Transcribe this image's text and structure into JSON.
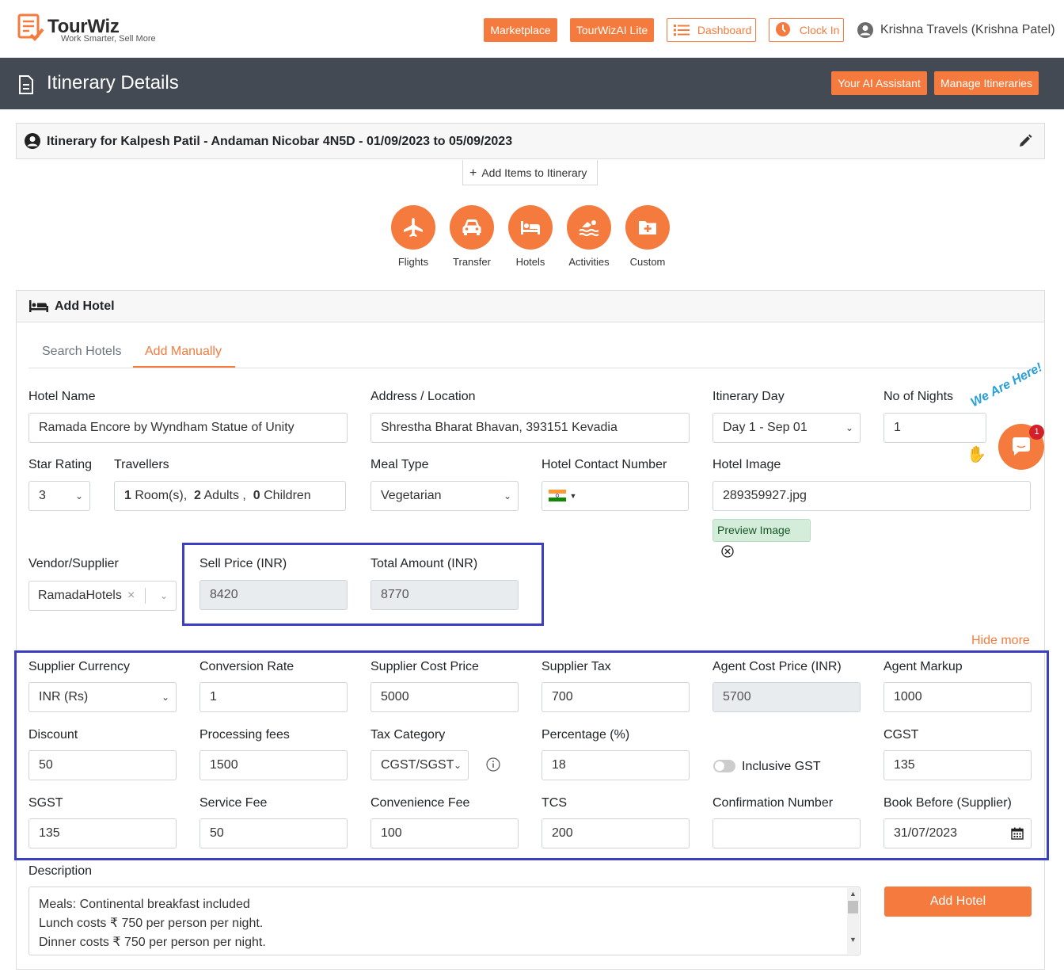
{
  "brand": {
    "name": "TourWiz",
    "tagline": "Work Smarter, Sell More"
  },
  "topnav": {
    "marketplace": "Marketplace",
    "tourwizai": "TourWizAI Lite",
    "dashboard": "Dashboard",
    "clock_in": "Clock In",
    "user": "Krishna Travels (Krishna Patel)"
  },
  "header": {
    "title": "Itinerary Details",
    "ai_assistant": "Your AI Assistant",
    "manage": "Manage Itineraries"
  },
  "itinerary": {
    "title": "Itinerary for Kalpesh Patil - Andaman Nicobar 4N5D - 01/09/2023 to 05/09/2023",
    "add_items": "Add Items to Itinerary"
  },
  "categories": [
    "Flights",
    "Transfer",
    "Hotels",
    "Activities",
    "Custom"
  ],
  "card": {
    "title": "Add Hotel",
    "tabs": [
      "Search Hotels",
      "Add Manually"
    ],
    "hide_more": "Hide more"
  },
  "form": {
    "hotel_name": {
      "label": "Hotel Name",
      "value": "Ramada Encore by Wyndham Statue of Unity"
    },
    "address": {
      "label": "Address / Location",
      "value": "Shrestha Bharat Bhavan, 393151 Kevadia"
    },
    "itinerary_day": {
      "label": "Itinerary Day",
      "value": "Day 1 - Sep 01"
    },
    "nights": {
      "label": "No of Nights",
      "value": "1"
    },
    "star_rating": {
      "label": "Star Rating",
      "value": "3"
    },
    "travellers": {
      "label": "Travellers",
      "rooms": "1",
      "rooms_text": "Room(s),",
      "adults": "2",
      "adults_text": "Adults ,",
      "children": "0",
      "children_text": "Children"
    },
    "meal_type": {
      "label": "Meal Type",
      "value": "Vegetarian"
    },
    "contact": {
      "label": "Hotel Contact Number"
    },
    "hotel_image": {
      "label": "Hotel Image",
      "value": "289359927.jpg",
      "preview": "Preview Image"
    },
    "vendor": {
      "label": "Vendor/Supplier",
      "value": "RamadaHotels"
    },
    "sell_price": {
      "label": "Sell Price (INR)",
      "value": "8420"
    },
    "total_amount": {
      "label": "Total Amount (INR)",
      "value": "8770"
    },
    "supplier_currency": {
      "label": "Supplier Currency",
      "value": "INR (Rs)"
    },
    "conversion_rate": {
      "label": "Conversion Rate",
      "value": "1"
    },
    "supplier_cost": {
      "label": "Supplier Cost Price",
      "value": "5000"
    },
    "supplier_tax": {
      "label": "Supplier Tax",
      "value": "700"
    },
    "agent_cost": {
      "label": "Agent Cost Price (INR)",
      "value": "5700"
    },
    "agent_markup": {
      "label": "Agent Markup",
      "value": "1000"
    },
    "discount": {
      "label": "Discount",
      "value": "50"
    },
    "processing_fees": {
      "label": "Processing fees",
      "value": "1500"
    },
    "tax_category": {
      "label": "Tax Category",
      "value": "CGST/SGST"
    },
    "percentage": {
      "label": "Percentage (%)",
      "value": "18"
    },
    "inclusive_gst": {
      "label": "Inclusive GST"
    },
    "cgst": {
      "label": "CGST",
      "value": "135"
    },
    "sgst": {
      "label": "SGST",
      "value": "135"
    },
    "service_fee": {
      "label": "Service Fee",
      "value": "50"
    },
    "convenience_fee": {
      "label": "Convenience Fee",
      "value": "100"
    },
    "tcs": {
      "label": "TCS",
      "value": "200"
    },
    "confirmation": {
      "label": "Confirmation Number",
      "value": ""
    },
    "book_before": {
      "label": "Book Before (Supplier)",
      "value": "31/07/2023"
    },
    "description": {
      "label": "Description",
      "lines": [
        "Meals: Continental breakfast included",
        "Lunch costs ₹ 750 per person per night.",
        "Dinner costs ₹ 750 per person per night."
      ]
    },
    "submit": "Add Hotel"
  },
  "chat": {
    "badge": "1",
    "banner": "We Are Here!"
  },
  "colors": {
    "accent": "#f47b3d",
    "header": "#434a54",
    "highlight": "#3b3fc3"
  }
}
